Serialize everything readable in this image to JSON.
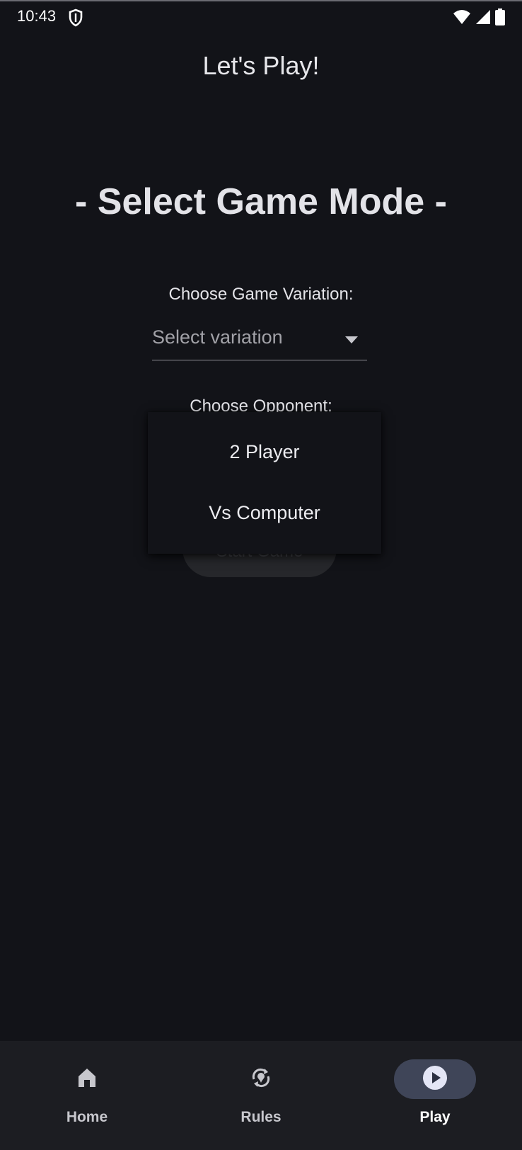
{
  "status_bar": {
    "time": "10:43",
    "icons": [
      "shield-icon",
      "wifi-icon",
      "cellular-icon",
      "battery-icon"
    ]
  },
  "app_bar": {
    "title": "Let's Play!"
  },
  "main": {
    "heading": "- Select Game Mode -",
    "variation_label": "Choose Game Variation:",
    "variation_placeholder": "Select variation",
    "opponent_label": "Choose Opponent:",
    "start_button_label": "Start Game"
  },
  "opponent_menu": {
    "items": [
      "2 Player",
      "Vs Computer"
    ]
  },
  "bottom_nav": {
    "items": [
      {
        "label": "Home",
        "icon": "home-icon"
      },
      {
        "label": "Rules",
        "icon": "rules-icon"
      },
      {
        "label": "Play",
        "icon": "play-icon"
      }
    ],
    "selected": "Play"
  },
  "colors": {
    "background": "#121318",
    "nav_background": "#1c1d22",
    "active_indicator": "#3f4558",
    "text_primary": "#e3e3e8"
  }
}
